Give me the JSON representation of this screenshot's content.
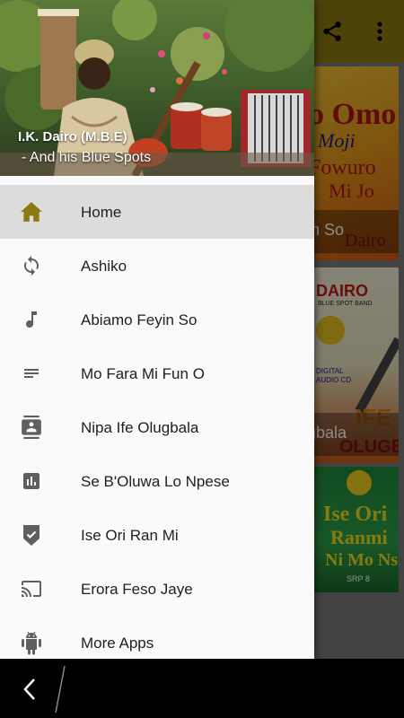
{
  "header": {
    "title": "I.K. Dairo (M.B.E)",
    "subtitle": "- And his Blue Spots"
  },
  "colors": {
    "accent": "#8c7a12",
    "icon_gray": "#5f5f5f",
    "active_bg": "#dcdcdc",
    "drawer_bg": "#fafafa"
  },
  "toolbar": {
    "share_icon": "share-icon",
    "overflow_icon": "more-vert-icon"
  },
  "menu": {
    "items": [
      {
        "label": "Home",
        "icon": "home-icon",
        "active": true
      },
      {
        "label": "Ashiko",
        "icon": "sync-icon",
        "active": false
      },
      {
        "label": "Abiamo Feyin So",
        "icon": "music-note-icon",
        "active": false
      },
      {
        "label": "Mo Fara Mi Fun O",
        "icon": "short-text-icon",
        "active": false
      },
      {
        "label": "Nipa Ife Olugbala",
        "icon": "contact-icon",
        "active": false
      },
      {
        "label": "Se B'Oluwa Lo Npese",
        "icon": "chart-icon",
        "active": false
      },
      {
        "label": "Ise Ori Ran Mi",
        "icon": "verified-badge-icon",
        "active": false
      },
      {
        "label": "Erora Feso Jaye",
        "icon": "cast-icon",
        "active": false
      },
      {
        "label": "More Apps",
        "icon": "android-icon",
        "active": false
      }
    ]
  },
  "background_cards": [
    {
      "caption": "in So",
      "art_text": [
        "o Omo",
        "Moji",
        "Fowuro",
        "Mi Jo",
        "Dairo"
      ]
    },
    {
      "caption": "gbala",
      "art_text": [
        "DAIRO",
        "BLUE SPOT BAND",
        "DIGITAL AUDIO CD",
        "IFE",
        "OLUGBALA"
      ]
    },
    {
      "caption": "",
      "art_text": [
        "Ise Ori",
        "Ranmi",
        "Ni Mo Nse",
        "SRP 8"
      ]
    }
  ],
  "navbar": {
    "back_icon": "back-chevron-icon"
  }
}
